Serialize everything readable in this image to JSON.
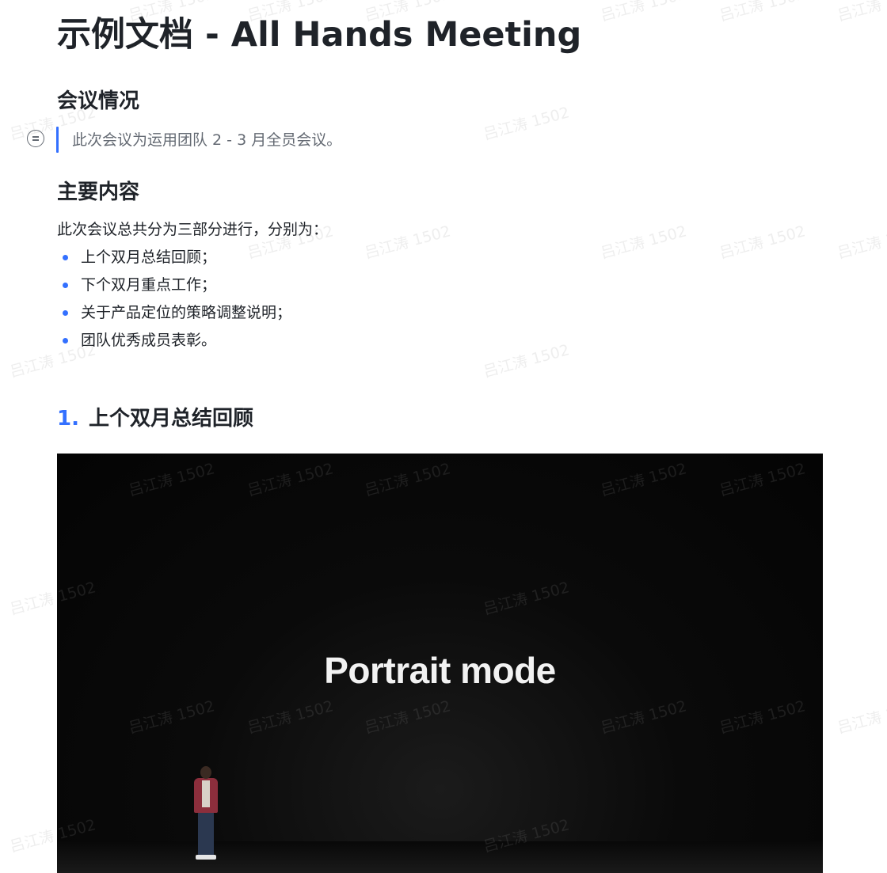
{
  "document": {
    "title": "示例文档 - All Hands Meeting",
    "sections": {
      "meeting_info": {
        "heading": "会议情况",
        "callout_icon": "list-circle-icon",
        "callout_text": "此次会议为运用团队 2 - 3 月全员会议。"
      },
      "main_content": {
        "heading": "主要内容",
        "intro": "此次会议总共分为三部分进行，分别为：",
        "bullets": [
          "上个双月总结回顾；",
          "下个双月重点工作；",
          "关于产品定位的策略调整说明；",
          "团队优秀成员表彰。"
        ]
      },
      "review": {
        "number": "1.",
        "heading": "上个双月总结回顾"
      }
    },
    "video": {
      "caption": "Portrait mode"
    },
    "watermark": "吕江涛 1502"
  },
  "colors": {
    "accent": "#3370ff",
    "text": "#1f2329",
    "muted": "#646a73",
    "video_bg": "#050505"
  }
}
